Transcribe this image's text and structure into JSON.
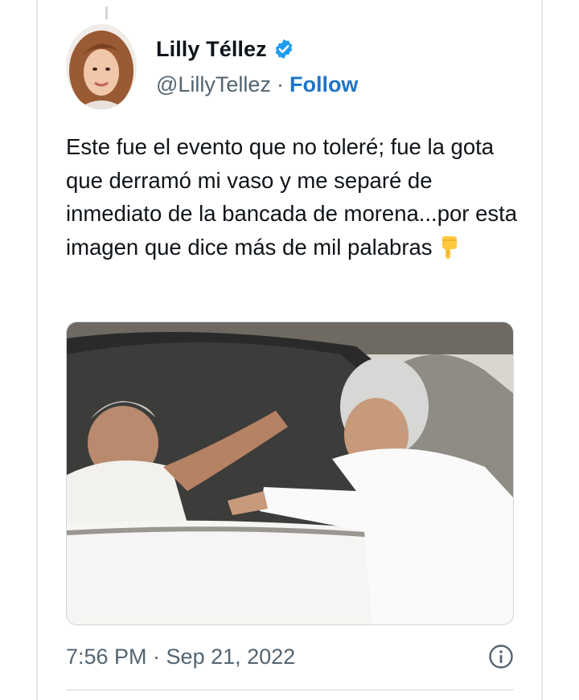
{
  "tweet": {
    "author": {
      "name": "Lilly Téllez",
      "handle": "@LillyTellez",
      "separator": "·",
      "follow_label": "Follow",
      "verified": true,
      "verified_color": "#1d9bf0"
    },
    "text": "Este fue el evento que no toleré; fue la gota que derramó mi vaso y me separé de inmediato de la bancada de morena...por esta imagen que dice más de mil palabras",
    "emoji": "backhand-index-pointing-down",
    "media": {
      "type": "photo",
      "icon": "photo"
    },
    "timestamp": "7:56 PM · Sep 21, 2022"
  },
  "colors": {
    "accent": "#1d74c8",
    "text_primary": "#0f1419",
    "text_secondary": "#536471",
    "border": "#cfd9de"
  }
}
